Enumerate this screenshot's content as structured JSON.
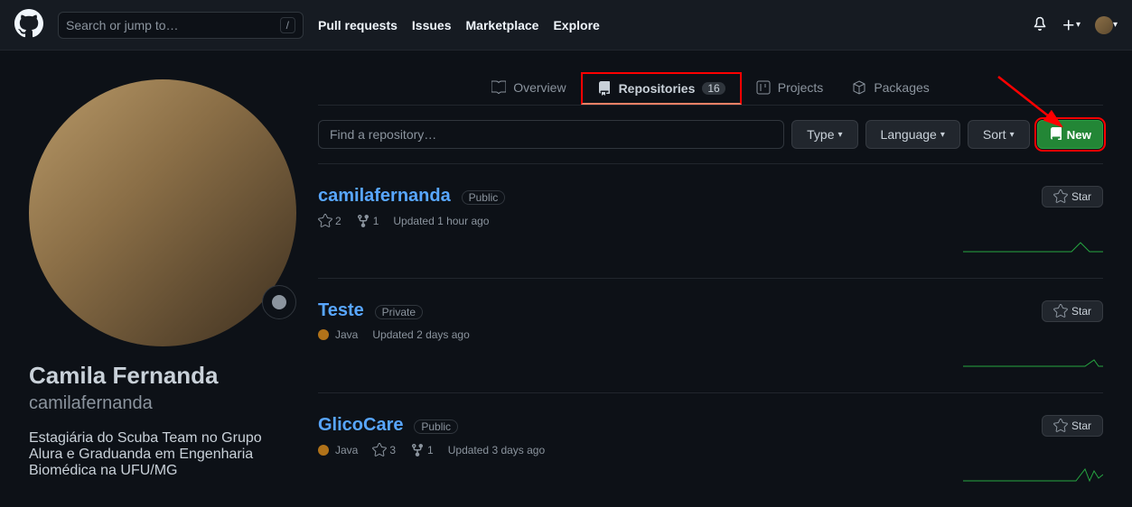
{
  "header": {
    "search_placeholder": "Search or jump to…",
    "slash": "/",
    "nav": [
      "Pull requests",
      "Issues",
      "Marketplace",
      "Explore"
    ]
  },
  "profile": {
    "full_name": "Camila Fernanda",
    "username": "camilafernanda",
    "bio": "Estagiária do Scuba Team no Grupo Alura e Graduanda em Engenharia Biomédica na UFU/MG"
  },
  "tabs": {
    "overview": "Overview",
    "repositories": "Repositories",
    "repo_count": "16",
    "projects": "Projects",
    "packages": "Packages"
  },
  "filters": {
    "find_placeholder": "Find a repository…",
    "type": "Type",
    "language": "Language",
    "sort": "Sort",
    "new": "New"
  },
  "repos": [
    {
      "name": "camilafernanda",
      "visibility": "Public",
      "stars": "2",
      "forks": "1",
      "lang": "",
      "updated": "Updated 1 hour ago",
      "star_label": "Star"
    },
    {
      "name": "Teste",
      "visibility": "Private",
      "stars": "",
      "forks": "",
      "lang": "Java",
      "updated": "Updated 2 days ago",
      "star_label": "Star"
    },
    {
      "name": "GlicoCare",
      "visibility": "Public",
      "stars": "3",
      "forks": "1",
      "lang": "Java",
      "updated": "Updated 3 days ago",
      "star_label": "Star"
    }
  ]
}
